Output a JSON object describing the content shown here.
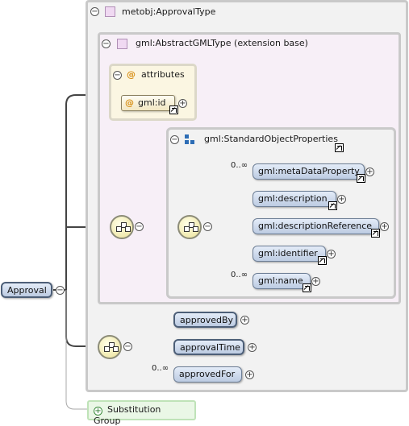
{
  "root": {
    "label": "Approval"
  },
  "type_box": {
    "title": "metobj:ApprovalType"
  },
  "extension": {
    "title": "gml:AbstractGMLType (extension base)"
  },
  "attributes": {
    "title": "attributes",
    "items": [
      {
        "label": "gml:id"
      }
    ]
  },
  "standard_props": {
    "title": "gml:StandardObjectProperties",
    "items": [
      {
        "label": "gml:metaDataProperty",
        "multiplicity": "0..∞"
      },
      {
        "label": "gml:description",
        "multiplicity": ""
      },
      {
        "label": "gml:descriptionReference",
        "multiplicity": ""
      },
      {
        "label": "gml:identifier",
        "multiplicity": ""
      },
      {
        "label": "gml:name",
        "multiplicity": "0..∞"
      }
    ]
  },
  "own_elements": [
    {
      "label": "approvedBy",
      "multiplicity": ""
    },
    {
      "label": "approvalTime",
      "multiplicity": ""
    },
    {
      "label": "approvedFor",
      "multiplicity": "0..∞"
    }
  ],
  "substitution": {
    "label": "Substitution Group"
  },
  "symbols": {
    "minus": "−",
    "plus": "+",
    "at": "@"
  },
  "colors": {
    "element_fill": "#c9d6ea",
    "attribute_fill": "#fbf6e2",
    "extension_fill": "#f7eff7"
  }
}
